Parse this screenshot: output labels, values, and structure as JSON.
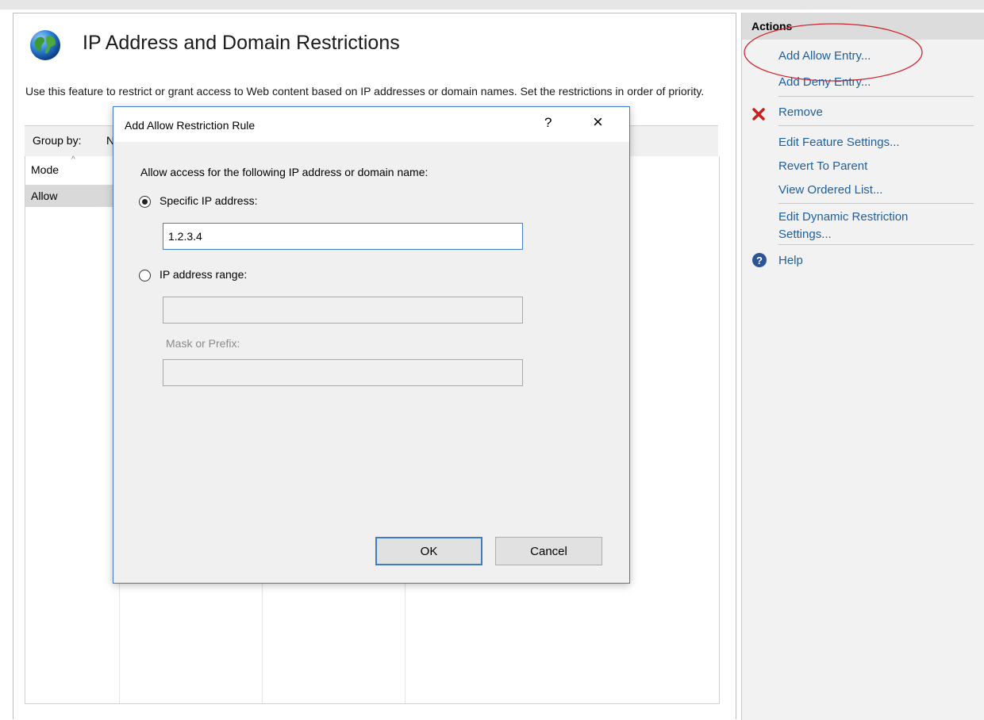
{
  "feature": {
    "title": "IP Address and Domain Restrictions",
    "description": "Use this feature to restrict or grant access to Web content based on IP addresses or domain names. Set the restrictions in order of priority."
  },
  "list": {
    "groupby_label": "Group by:",
    "groupby_value": "N",
    "columns": [
      "Mode"
    ],
    "rows": [
      {
        "mode": "Allow"
      }
    ]
  },
  "actions": {
    "title": "Actions",
    "items": [
      {
        "label": "Add Allow Entry...",
        "icon": ""
      },
      {
        "label": "Add Deny Entry...",
        "icon": ""
      },
      {
        "label": "Remove",
        "icon": "remove-x-icon"
      },
      {
        "label": "Edit Feature Settings...",
        "icon": ""
      },
      {
        "label": "Revert To Parent",
        "icon": ""
      },
      {
        "label": "View Ordered List...",
        "icon": ""
      },
      {
        "label": "Edit Dynamic Restriction Settings...",
        "icon": ""
      },
      {
        "label": "Help",
        "icon": "help-icon"
      }
    ]
  },
  "dialog": {
    "title": "Add Allow Restriction Rule",
    "help_glyph": "?",
    "close_glyph": "×",
    "prompt": "Allow access for the following IP address or domain name:",
    "specific_ip_label": "Specific IP address:",
    "specific_ip_value": "1.2.3.4",
    "range_label": "IP address range:",
    "range_value": "",
    "mask_label": "Mask or Prefix:",
    "mask_value": "",
    "selected_option": "specific",
    "ok_label": "OK",
    "cancel_label": "Cancel"
  },
  "colors": {
    "link": "#1e5f9e",
    "dialog_border": "#3a7cc9",
    "annotation": "#d0202a",
    "remove_icon": "#c8201c",
    "help_icon": "#2b5597"
  }
}
